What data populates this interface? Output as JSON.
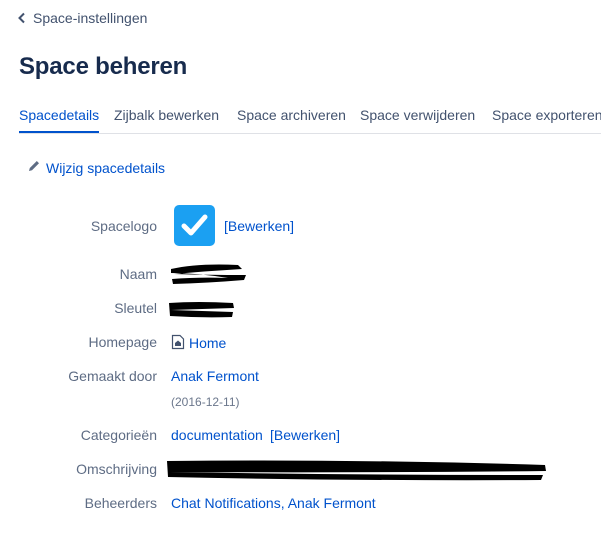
{
  "breadcrumb": {
    "back_label": "Space-instellingen"
  },
  "page": {
    "title": "Space beheren"
  },
  "tabs": [
    {
      "label": "Spacedetails",
      "active": true
    },
    {
      "label": "Zijbalk bewerken",
      "active": false
    },
    {
      "label": "Space archiveren",
      "active": false
    },
    {
      "label": "Space verwijderen",
      "active": false
    },
    {
      "label": "Space exporteren",
      "active": false
    }
  ],
  "actions": {
    "edit_details_label": "Wijzig spacedetails"
  },
  "details": {
    "logo": {
      "label": "Spacelogo",
      "edit_link": "[Bewerken]"
    },
    "name": {
      "label": "Naam",
      "value": ""
    },
    "key": {
      "label": "Sleutel",
      "value": ""
    },
    "homepage": {
      "label": "Homepage",
      "value": "Home"
    },
    "created_by": {
      "label": "Gemaakt door",
      "value": "Anak Fermont",
      "date": "(2016-12-11)"
    },
    "categories": {
      "label": "Categorieën",
      "value": "documentation",
      "edit_link": "[Bewerken]"
    },
    "description": {
      "label": "Omschrijving",
      "value": ""
    },
    "admins": {
      "label": "Beheerders",
      "value": "Chat Notifications, Anak Fermont"
    }
  },
  "colors": {
    "link": "#0052cc",
    "label": "#5e6c84",
    "logo_bg": "#1ba0f2",
    "tab_active": "#0052cc",
    "redaction": "#000000"
  },
  "icons": {
    "back": "chevron-left-icon",
    "edit": "pencil-icon",
    "logo": "checkmark-icon",
    "page": "page-home-icon"
  }
}
